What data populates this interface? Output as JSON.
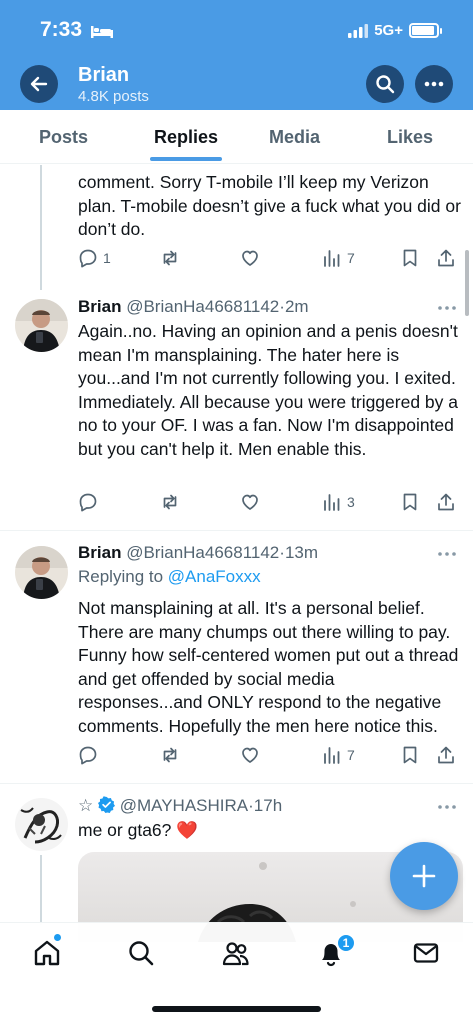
{
  "status_bar": {
    "time": "7:33",
    "network": "5G+",
    "battery_level": 0.9
  },
  "header": {
    "name": "Brian",
    "posts": "4.8K posts"
  },
  "tabs": [
    {
      "label": "Posts",
      "active": false
    },
    {
      "label": "Replies",
      "active": true
    },
    {
      "label": "Media",
      "active": false
    },
    {
      "label": "Likes",
      "active": false
    }
  ],
  "tweets": [
    {
      "text": "comment. Sorry T-mobile I’ll keep my Verizon plan. T-mobile doesn’t give a fuck what you did or don’t do.",
      "replies": "1",
      "reposts": "",
      "likes": "",
      "views": "7"
    },
    {
      "name": "Brian",
      "handle": "@BrianHa46681142",
      "time": "2m",
      "text": "Again..no. Having an opinion and a penis doesn't mean I'm mansplaining. The hater here is you...and I'm not currently following you. I exited. Immediately. All because you were triggered by a no to your OF. I was a fan. Now I'm disappointed but you can't help it. Men enable this.",
      "replies": "",
      "reposts": "",
      "likes": "",
      "views": "3"
    },
    {
      "name": "Brian",
      "handle": "@BrianHa46681142",
      "time": "13m",
      "replying_prefix": "Replying to ",
      "replying_to": "@AnaFoxxx",
      "text": "Not mansplaining at all. It's a personal belief. There are many chumps out there willing to pay. Funny how self-centered women put out a thread and get offended by social media responses...and ONLY respond to the negative comments. Hopefully the men here notice this.",
      "replies": "",
      "reposts": "",
      "likes": "",
      "views": "7"
    },
    {
      "prefix": "☆",
      "handle": "@MAYHASHIRA",
      "time": "17h",
      "text": "me or gta6? ❤️"
    }
  ],
  "bottom_nav": {
    "notification_count": "1"
  },
  "colors": {
    "accent": "#4a9be5",
    "link": "#1d9bf0",
    "header_bg": "#4a9be5",
    "verified": "#1d9bf0"
  },
  "icons": [
    "bed-icon",
    "signal-icon",
    "battery-icon",
    "back-arrow-icon",
    "search-icon",
    "more-icon",
    "reply-icon",
    "repost-icon",
    "like-icon",
    "views-icon",
    "bookmark-icon",
    "share-icon",
    "verified-icon",
    "plus-icon",
    "home-icon",
    "people-icon",
    "bell-icon",
    "mail-icon"
  ]
}
